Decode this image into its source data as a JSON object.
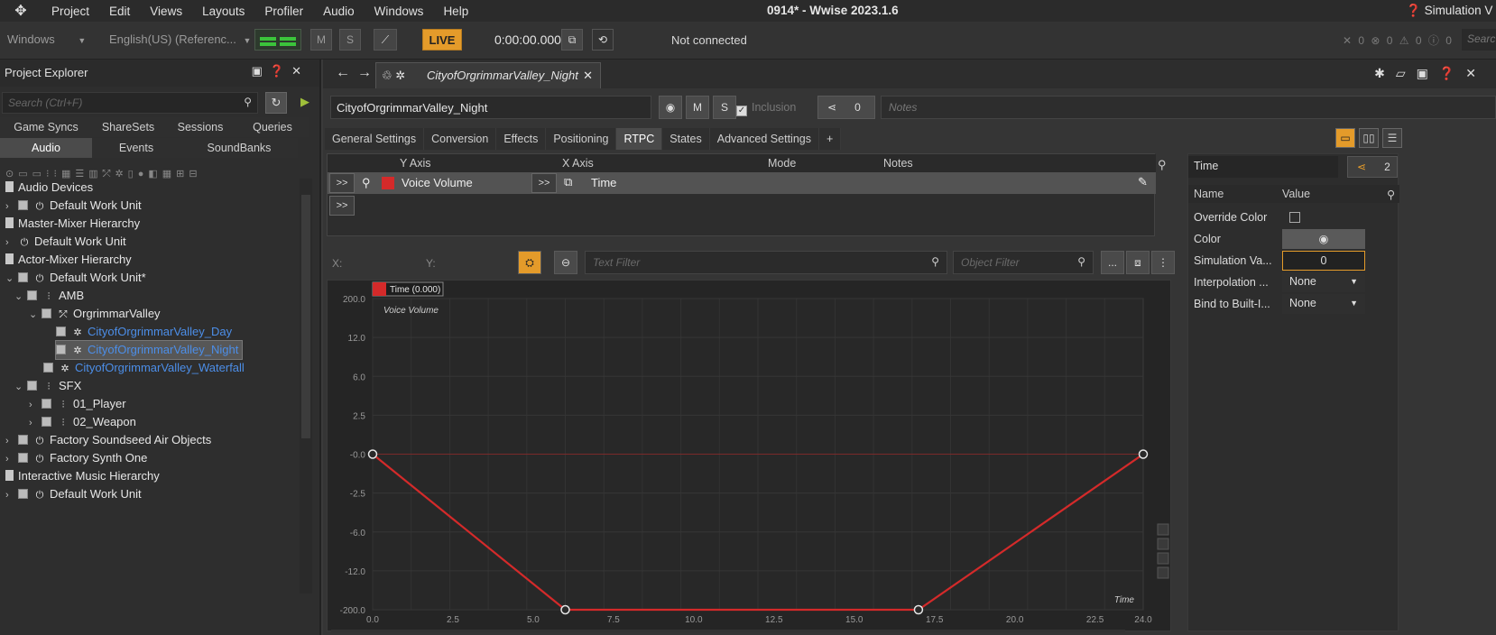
{
  "menubar": {
    "items": [
      "Project",
      "Edit",
      "Views",
      "Layouts",
      "Profiler",
      "Audio",
      "Windows",
      "Help"
    ],
    "title": "0914* - Wwise 2023.1.6",
    "simulation": "Simulation V"
  },
  "toolbar": {
    "platform": "Windows",
    "language": "English(US) (Referenc...",
    "mute": "M",
    "solo": "S",
    "live": "LIVE",
    "time": "0:00:00.000",
    "status": "Not connected",
    "counts": "✕ 0 ⊗ 0 ⚠ 0 ⓘ 0",
    "search": "Searc"
  },
  "project_explorer": {
    "title": "Project Explorer",
    "search_placeholder": "Search (Ctrl+F)",
    "tabs_row1": [
      "Game Syncs",
      "ShareSets",
      "Sessions",
      "Queries"
    ],
    "tabs_row2": [
      "Audio",
      "Events",
      "SoundBanks"
    ],
    "tree": [
      {
        "label": "Audio Devices"
      },
      {
        "label": "Default Work Unit"
      },
      {
        "label": "Master-Mixer Hierarchy"
      },
      {
        "label": "Default Work Unit"
      },
      {
        "label": "Actor-Mixer Hierarchy"
      },
      {
        "label": "Default Work Unit*"
      },
      {
        "label": "AMB"
      },
      {
        "label": "OrgrimmarValley"
      },
      {
        "label": "CityofOrgrimmarValley_Day"
      },
      {
        "label": "CityofOrgrimmarValley_Night"
      },
      {
        "label": "CityofOrgrimmarValley_Waterfall"
      },
      {
        "label": "SFX"
      },
      {
        "label": "01_Player"
      },
      {
        "label": "02_Weapon"
      },
      {
        "label": "Factory Soundseed Air Objects"
      },
      {
        "label": "Factory Synth One"
      },
      {
        "label": "Interactive Music Hierarchy"
      },
      {
        "label": "Default Work Unit"
      }
    ]
  },
  "editor": {
    "tab_label": "CityofOrgrimmarValley_Night",
    "object_name": "CityofOrgrimmarValley_Night",
    "mute": "M",
    "solo": "S",
    "inclusion": "Inclusion",
    "ref_count": "0",
    "notes_placeholder": "Notes",
    "tabs": [
      "General Settings",
      "Conversion",
      "Effects",
      "Positioning",
      "RTPC",
      "States",
      "Advanced Settings",
      "+"
    ],
    "rtpc_table": {
      "headers": [
        "Y Axis",
        "X Axis",
        "Mode",
        "Notes"
      ],
      "row": {
        "y_axis": "Voice Volume",
        "x_axis": "Time"
      },
      "expand": ">>"
    },
    "graph_bar": {
      "x_label": "X:",
      "y_label": "Y:",
      "text_filter": "Text Filter",
      "object_filter": "Object Filter",
      "more": "..."
    }
  },
  "chart_data": {
    "type": "line",
    "legend": "Time (0.000)",
    "curve_label": "Voice Volume",
    "xlabel": "Time",
    "x_ticks": [
      "0.0",
      "2.5",
      "5.0",
      "7.5",
      "10.0",
      "12.5",
      "15.0",
      "17.5",
      "20.0",
      "22.5",
      "24.0"
    ],
    "y_ticks": [
      "200.0",
      "12.0",
      "6.0",
      "2.5",
      "-0.0",
      "-2.5",
      "-6.0",
      "-12.0",
      "-200.0"
    ],
    "points": [
      {
        "x": 0.0,
        "y": "-0.0"
      },
      {
        "x": 6.0,
        "y": "-200.0"
      },
      {
        "x": 17.0,
        "y": "-200.0"
      },
      {
        "x": 24.0,
        "y": "-0.0"
      }
    ],
    "line_color": "#d42a2a"
  },
  "properties": {
    "name": "Time",
    "count": "2",
    "headers": [
      "Name",
      "Value"
    ],
    "rows": [
      {
        "name": "Override Color",
        "value": ""
      },
      {
        "name": "Color",
        "value": ""
      },
      {
        "name": "Simulation Va...",
        "value": "0"
      },
      {
        "name": "Interpolation ...",
        "value": "None"
      },
      {
        "name": "Bind to Built-I...",
        "value": "None"
      }
    ]
  },
  "colors": {
    "accent": "#e49b2a",
    "link": "#4c8ee8",
    "curve": "#d42a2a"
  }
}
